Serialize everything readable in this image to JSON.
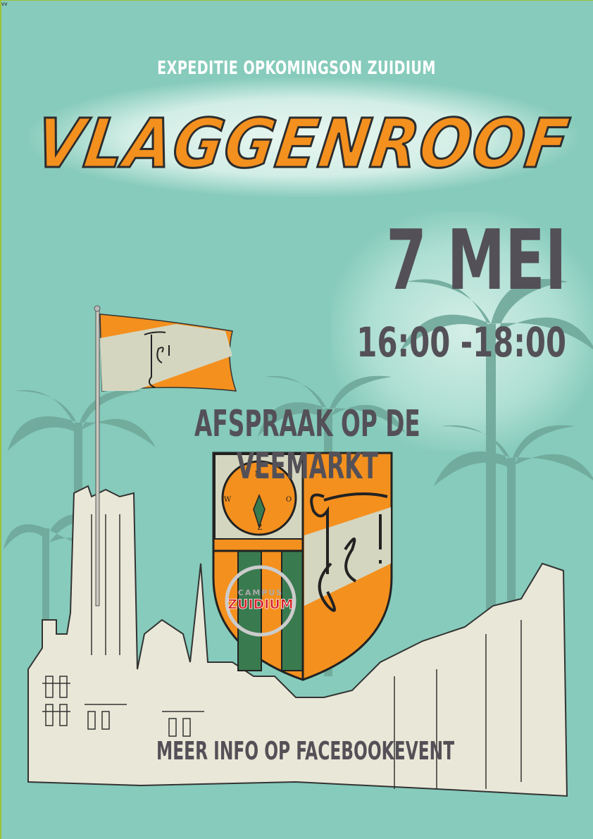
{
  "corner_mark": "vv",
  "subtitle": "EXPEDITIE OPKOMINGSON ZUIDIUM",
  "title": "VLAGGENROOF",
  "date": "7 MEI",
  "time": "16:00 -18:00",
  "meeting_point": "AFSPRAAK OP DE VEEMARKT",
  "more_info": "MEER INFO OP FACEBOOKEVENT",
  "shield": {
    "compass_labels": [
      "N",
      "W",
      "O",
      "Z"
    ],
    "logo_top": "CAMPUS",
    "logo_bottom": "ZUIDIUM"
  },
  "colors": {
    "background": "#86cbbb",
    "orange": "#f4901e",
    "text": "#545057",
    "green": "#3a7a4f",
    "cream": "#d4d6c0"
  }
}
